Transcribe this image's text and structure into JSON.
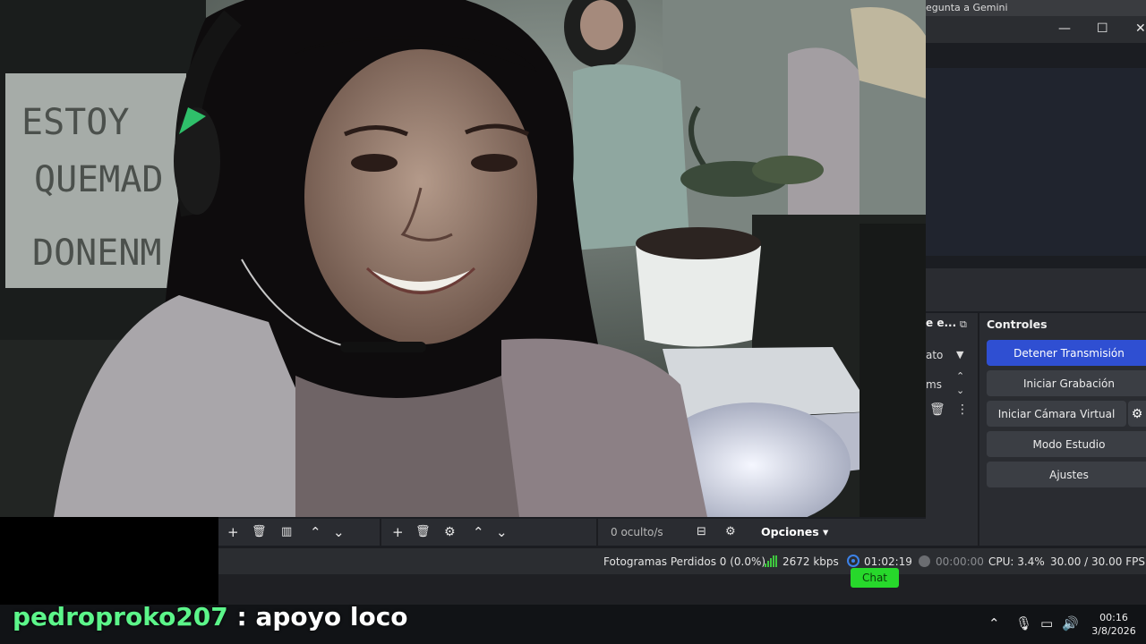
{
  "browser": {
    "tab_title": "egunta a Gemini"
  },
  "webcam": {
    "sign_lines": [
      "ESTOY",
      "QUEMAD",
      "DONENM"
    ]
  },
  "sources_dock": {
    "header": "e e...",
    "row1": "ato",
    "row2": "ms"
  },
  "controls": {
    "header": "Controles",
    "stop_stream": "Detener Transmisión",
    "start_record": "Iniciar Grabación",
    "start_virtualcam": "Iniciar Cámara Virtual",
    "studio_mode": "Modo Estudio",
    "settings": "Ajustes"
  },
  "toolbar": {
    "hidden_label": "0 oculto/s",
    "options_label": "Opciones"
  },
  "statusbar": {
    "dropped_frames": "Fotogramas Perdidos 0 (0.0%)",
    "bitrate": "2672 kbps",
    "stream_time": "01:02:19",
    "record_time": "00:00:00",
    "cpu": "CPU: 3.4%",
    "fps": "30.00 / 30.00 FPS"
  },
  "chat_button": "Chat",
  "chat_overlay": {
    "username": "pedroproko207",
    "message": " : apoyo loco"
  },
  "taskbar": {
    "time": "00:16",
    "date": "3/8/2026"
  },
  "colors": {
    "primary_button": "#2f4fd2",
    "chat_username": "#5cf58a",
    "bitrate_green": "#3fc93f",
    "live_blue": "#3c82e8"
  }
}
